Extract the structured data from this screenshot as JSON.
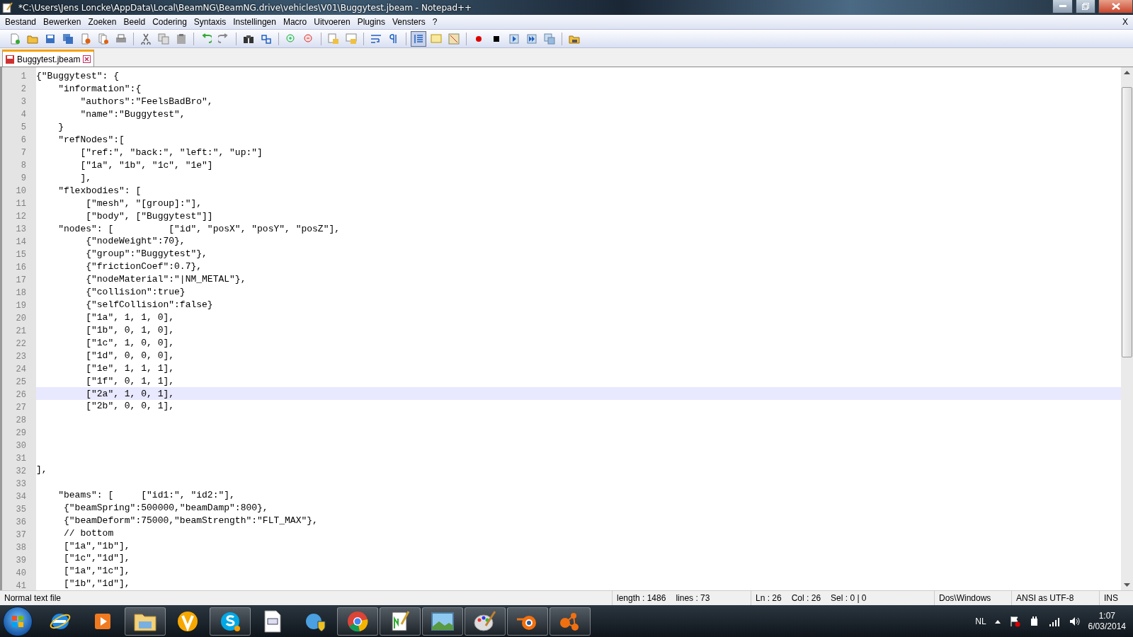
{
  "window": {
    "title": "*C:\\Users\\Jens Loncke\\AppData\\Local\\BeamNG\\BeamNG.drive\\vehicles\\V01\\Buggytest.jbeam - Notepad++"
  },
  "menu": {
    "items": [
      "Bestand",
      "Bewerken",
      "Zoeken",
      "Beeld",
      "Codering",
      "Syntaxis",
      "Instellingen",
      "Macro",
      "Uitvoeren",
      "Plugins",
      "Vensters",
      "?"
    ],
    "close": "X"
  },
  "tabs": [
    {
      "label": "Buggytest.jbeam",
      "selected": true
    }
  ],
  "editor": {
    "lines": [
      {
        "number": "1",
        "text": "{\"Buggytest\": {",
        "selected": false
      },
      {
        "number": "2",
        "text": "    \"information\":{",
        "selected": false
      },
      {
        "number": "3",
        "text": "        \"authors\":\"FeelsBadBro\",",
        "selected": false
      },
      {
        "number": "4",
        "text": "        \"name\":\"Buggytest\",",
        "selected": false
      },
      {
        "number": "5",
        "text": "    }",
        "selected": false
      },
      {
        "number": "6",
        "text": "    \"refNodes\":[",
        "selected": false
      },
      {
        "number": "7",
        "text": "        [\"ref:\", \"back:\", \"left:\", \"up:\"]",
        "selected": false
      },
      {
        "number": "8",
        "text": "        [\"1a\", \"1b\", \"1c\", \"1e\"]",
        "selected": false
      },
      {
        "number": "9",
        "text": "        ],",
        "selected": false
      },
      {
        "number": "10",
        "text": "    \"flexbodies\": [",
        "selected": false
      },
      {
        "number": "11",
        "text": "         [\"mesh\", \"[group]:\"],",
        "selected": false
      },
      {
        "number": "12",
        "text": "         [\"body\", [\"Buggytest\"]]",
        "selected": false
      },
      {
        "number": "13",
        "text": "    \"nodes\": [          [\"id\", \"posX\", \"posY\", \"posZ\"],",
        "selected": false
      },
      {
        "number": "14",
        "text": "         {\"nodeWeight\":70},",
        "selected": false
      },
      {
        "number": "15",
        "text": "         {\"group\":\"Buggytest\"},",
        "selected": false
      },
      {
        "number": "16",
        "text": "         {\"frictionCoef\":0.7},",
        "selected": false
      },
      {
        "number": "17",
        "text": "         {\"nodeMaterial\":\"|NM_METAL\"},",
        "selected": false
      },
      {
        "number": "18",
        "text": "         {\"collision\":true}",
        "selected": false
      },
      {
        "number": "19",
        "text": "         {\"selfCollision\":false}",
        "selected": false
      },
      {
        "number": "20",
        "text": "         [\"1a\", 1, 1, 0],",
        "selected": false
      },
      {
        "number": "21",
        "text": "         [\"1b\", 0, 1, 0],",
        "selected": false
      },
      {
        "number": "22",
        "text": "         [\"1c\", 1, 0, 0],",
        "selected": false
      },
      {
        "number": "23",
        "text": "         [\"1d\", 0, 0, 0],",
        "selected": false
      },
      {
        "number": "24",
        "text": "         [\"1e\", 1, 1, 1],",
        "selected": false
      },
      {
        "number": "25",
        "text": "         [\"1f\", 0, 1, 1],",
        "selected": false
      },
      {
        "number": "26",
        "text": "         [\"2a\", 1, 0, 1],",
        "selected": true
      },
      {
        "number": "27",
        "text": "         [\"2b\", 0, 0, 1],",
        "selected": false
      },
      {
        "number": "28",
        "selected": false
      },
      {
        "number": "29",
        "selected": false
      },
      {
        "number": "30",
        "selected": false
      },
      {
        "number": "31",
        "selected": false
      },
      {
        "number": "32",
        "text": "],",
        "selected": false
      },
      {
        "number": "33",
        "selected": false
      },
      {
        "number": "34",
        "text": "    \"beams\": [     [\"id1:\", \"id2:\"],",
        "selected": false
      },
      {
        "number": "35",
        "text": "     {\"beamSpring\":500000,\"beamDamp\":800},",
        "selected": false
      },
      {
        "number": "36",
        "text": "     {\"beamDeform\":75000,\"beamStrength\":\"FLT_MAX\"},",
        "selected": false
      },
      {
        "number": "37",
        "text": "     // bottom",
        "selected": false
      },
      {
        "number": "38",
        "text": "     [\"1a\",\"1b\"],",
        "selected": false
      },
      {
        "number": "39",
        "text": "     [\"1c\",\"1d\"],",
        "selected": false
      },
      {
        "number": "40",
        "text": "     [\"1a\",\"1c\"],",
        "selected": false
      },
      {
        "number": "41",
        "text": "     [\"1b\",\"1d\"],",
        "selected": false
      }
    ]
  },
  "status_bar": {
    "file_type": "Normal text file",
    "length": "length : 1486",
    "lines": "lines : 73",
    "ln": "Ln : 26",
    "col": "Col : 26",
    "sel": "Sel : 0 | 0",
    "eol": "Dos\\Windows",
    "encoding": "ANSI as UTF-8",
    "mode": "INS"
  },
  "taskbar": {
    "items": [
      {
        "kind": "ie",
        "running": false
      },
      {
        "kind": "media",
        "running": false
      },
      {
        "kind": "folder",
        "running": true
      },
      {
        "kind": "vapp",
        "running": false
      },
      {
        "kind": "skype",
        "running": true
      },
      {
        "kind": "doc",
        "running": false
      },
      {
        "kind": "globe",
        "running": false
      },
      {
        "kind": "chrome",
        "running": true
      },
      {
        "kind": "editor",
        "running": true
      },
      {
        "kind": "photo",
        "running": true
      },
      {
        "kind": "paint",
        "running": true
      },
      {
        "kind": "blender",
        "running": true
      },
      {
        "kind": "hub",
        "running": true
      }
    ],
    "language": "NL",
    "time": "1:07",
    "date": "6/03/2014"
  }
}
